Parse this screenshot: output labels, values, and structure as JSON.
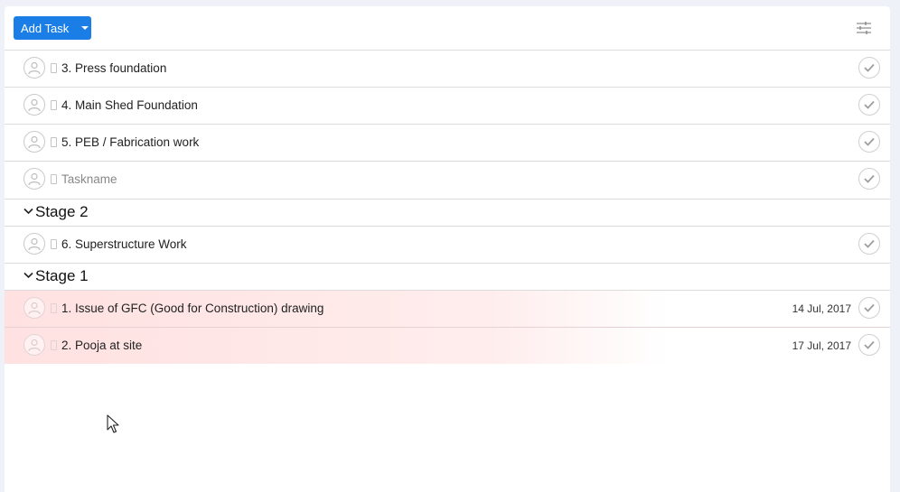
{
  "toolbar": {
    "add_task_label": "Add Task"
  },
  "tasks_top": [
    {
      "name": "3. Press foundation",
      "placeholder": false
    },
    {
      "name": "4. Main Shed Foundation",
      "placeholder": false
    },
    {
      "name": "5. PEB / Fabrication work",
      "placeholder": false
    },
    {
      "name": "Taskname",
      "placeholder": true
    }
  ],
  "sections": [
    {
      "title": "Stage 2",
      "tasks": [
        {
          "name": "6. Superstructure Work",
          "due": ""
        }
      ]
    },
    {
      "title": "Stage 1",
      "tasks": [
        {
          "name": "1. Issue of GFC (Good for Construction) drawing",
          "due": "14 Jul, 2017",
          "overdue": true
        },
        {
          "name": "2. Pooja at site",
          "due": "17 Jul, 2017",
          "overdue": true
        }
      ]
    }
  ],
  "colors": {
    "accent": "#1a7ee6",
    "overdue_bg": "#ffe3e3"
  }
}
